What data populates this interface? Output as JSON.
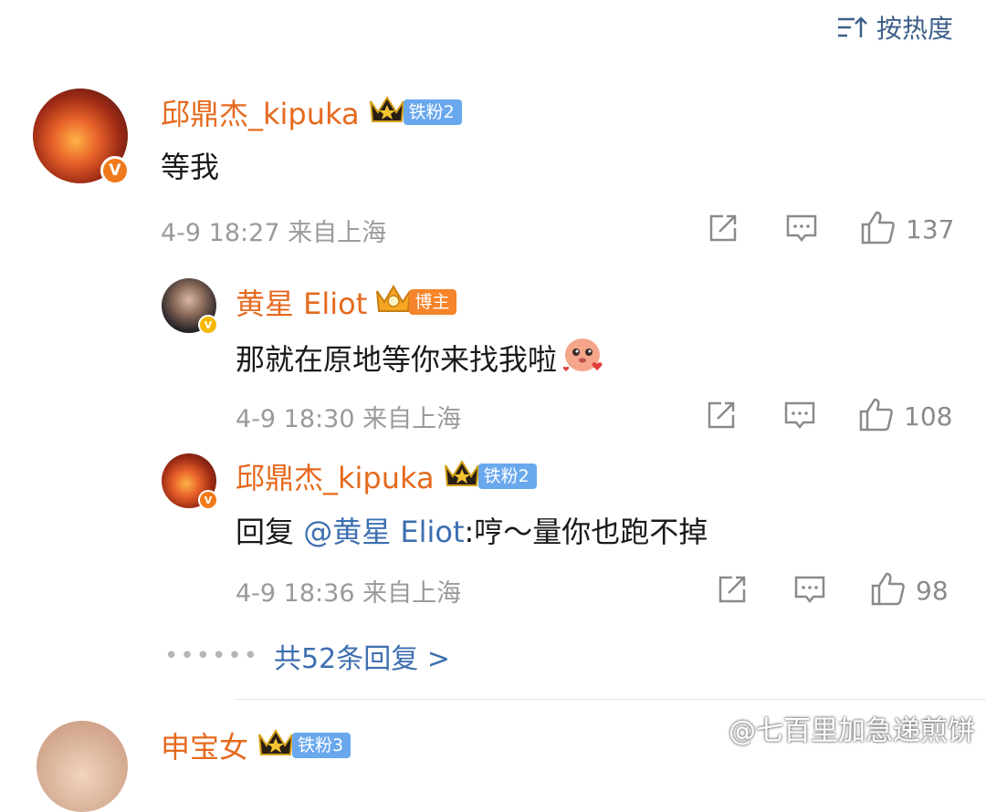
{
  "sort": {
    "label": "按热度"
  },
  "comments": [
    {
      "username": "邱鼎杰_kipuka",
      "badge_label": "铁粉",
      "badge_level": "2",
      "text": "等我",
      "time": "4-9 18:27",
      "location": "来自上海",
      "likes": "137",
      "verified_color": "#f07a1b",
      "replies": [
        {
          "username": "黄星 Eliot",
          "badge_label": "博主",
          "text": "那就在原地等你来找我啦",
          "time": "4-9 18:30",
          "location": "来自上海",
          "likes": "108",
          "verified_color": "#f5b800"
        },
        {
          "username": "邱鼎杰_kipuka",
          "badge_label": "铁粉",
          "badge_level": "2",
          "reply_prefix": "回复",
          "mention": "@黄星 Eliot",
          "text_after": ":哼～量你也跑不掉",
          "time": "4-9 18:36",
          "location": "来自上海",
          "likes": "98",
          "verified_color": "#f07a1b"
        }
      ],
      "more_replies": "共52条回复 >"
    },
    {
      "username": "申宝女",
      "badge_label": "铁粉",
      "badge_level": "3"
    }
  ],
  "watermark": "@七百里加急递煎饼",
  "colors": {
    "username": "#e56a1e",
    "link": "#3d6fb0",
    "meta": "#9a9a9a",
    "fan_badge": "#6aa8ee",
    "blogger_badge": "#f5842a"
  }
}
